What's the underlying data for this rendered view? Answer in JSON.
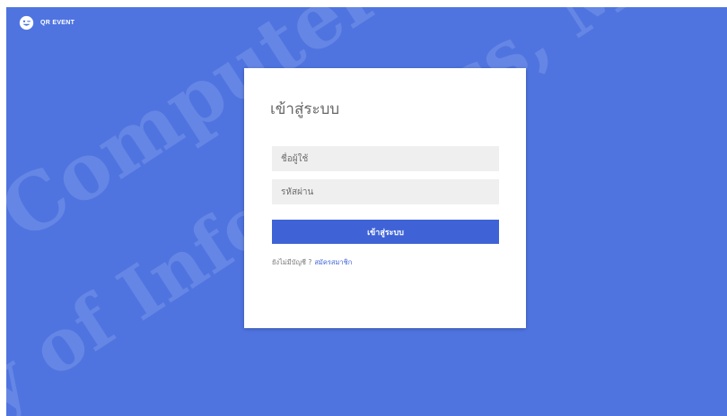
{
  "header": {
    "brand_name": "QR EVENT",
    "logo_icon": "smiley-face-icon"
  },
  "watermark": {
    "line1": "Computer Science, M",
    "line2": "y of Informatics, M"
  },
  "login": {
    "title": "เข้าสู่ระบบ",
    "username_placeholder": "ชื่อผู้ใช้",
    "password_placeholder": "รหัสผ่าน",
    "submit_label": "เข้าสู่ระบบ",
    "no_account_text": "ยังไม่มีบัญชี ?",
    "register_link": "สมัครสมาชิก"
  },
  "colors": {
    "background": "#4f74e0",
    "button": "#3f63d6",
    "field": "#efefef",
    "card": "#ffffff"
  }
}
